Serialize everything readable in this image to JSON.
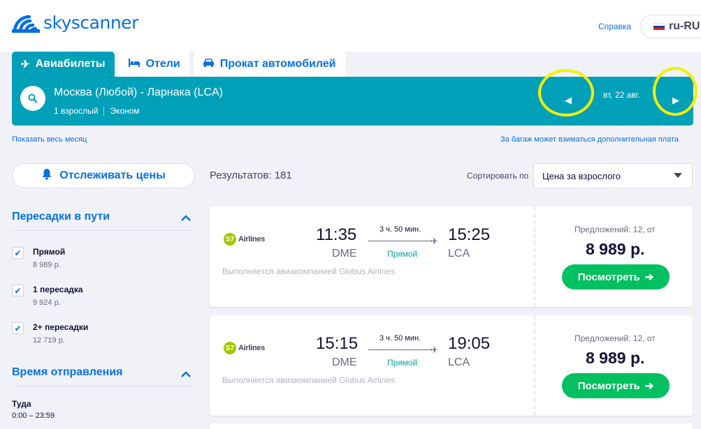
{
  "header": {
    "logo_text": "skyscanner",
    "help_label": "Справка",
    "locale_label": "ru-RU",
    "brand_color": "#0770e3"
  },
  "tabs": [
    {
      "label": "Авиабилеты",
      "icon": "airplane-icon",
      "active": true
    },
    {
      "label": "Отели",
      "icon": "bed-icon",
      "active": false
    },
    {
      "label": "Прокат автомобилей",
      "icon": "car-icon",
      "active": false
    }
  ],
  "search": {
    "route": "Москва (Любой) - Ларнака (LCA)",
    "passengers": "1 взрослый",
    "cabin": "Эконом",
    "date": "вт, 22 авг.",
    "bar_color": "#00a0b9"
  },
  "links": {
    "show_month": "Показать весь месяц",
    "baggage": "За багаж может взиматься дополнительная плата"
  },
  "sidebar": {
    "track_prices": "Отслеживать цены",
    "stops_title": "Пересадки в пути",
    "stops": [
      {
        "label": "Прямой",
        "price": "8 989 р.",
        "checked": true
      },
      {
        "label": "1 пересадка",
        "price": "9 924 р.",
        "checked": true
      },
      {
        "label": "2+ пересадки",
        "price": "12 719 р.",
        "checked": true
      }
    ],
    "departure_title": "Время отправления",
    "departure_dir": "Туда",
    "departure_range": "0:00 – 23:59"
  },
  "results": {
    "count_label": "Результатов: 181",
    "sort_label": "Сортировать по",
    "sort_value": "Цена за взрослого",
    "items": [
      {
        "airline": "Airlines",
        "dep_time": "11:35",
        "dep_code": "DME",
        "duration": "3 ч. 50 мин.",
        "stops": "Прямой",
        "arr_time": "15:25",
        "arr_code": "LCA",
        "operated_by": "Выполняется авиакомпанией Globus Airlines",
        "offers": "Предложений: 12, от",
        "price": "8 989 р.",
        "button": "Посмотреть"
      },
      {
        "airline": "Airlines",
        "dep_time": "15:15",
        "dep_code": "DME",
        "duration": "3 ч. 50 мин.",
        "stops": "Прямой",
        "arr_time": "19:05",
        "arr_code": "LCA",
        "operated_by": "Выполняется авиакомпанией Globus Airlines",
        "offers": "Предложений: 12, от",
        "price": "8 989 р.",
        "button": "Посмотреть"
      }
    ]
  },
  "colors": {
    "cta_green": "#00c060",
    "direct_green": "#00a698",
    "highlight_yellow": "#f3f000"
  }
}
